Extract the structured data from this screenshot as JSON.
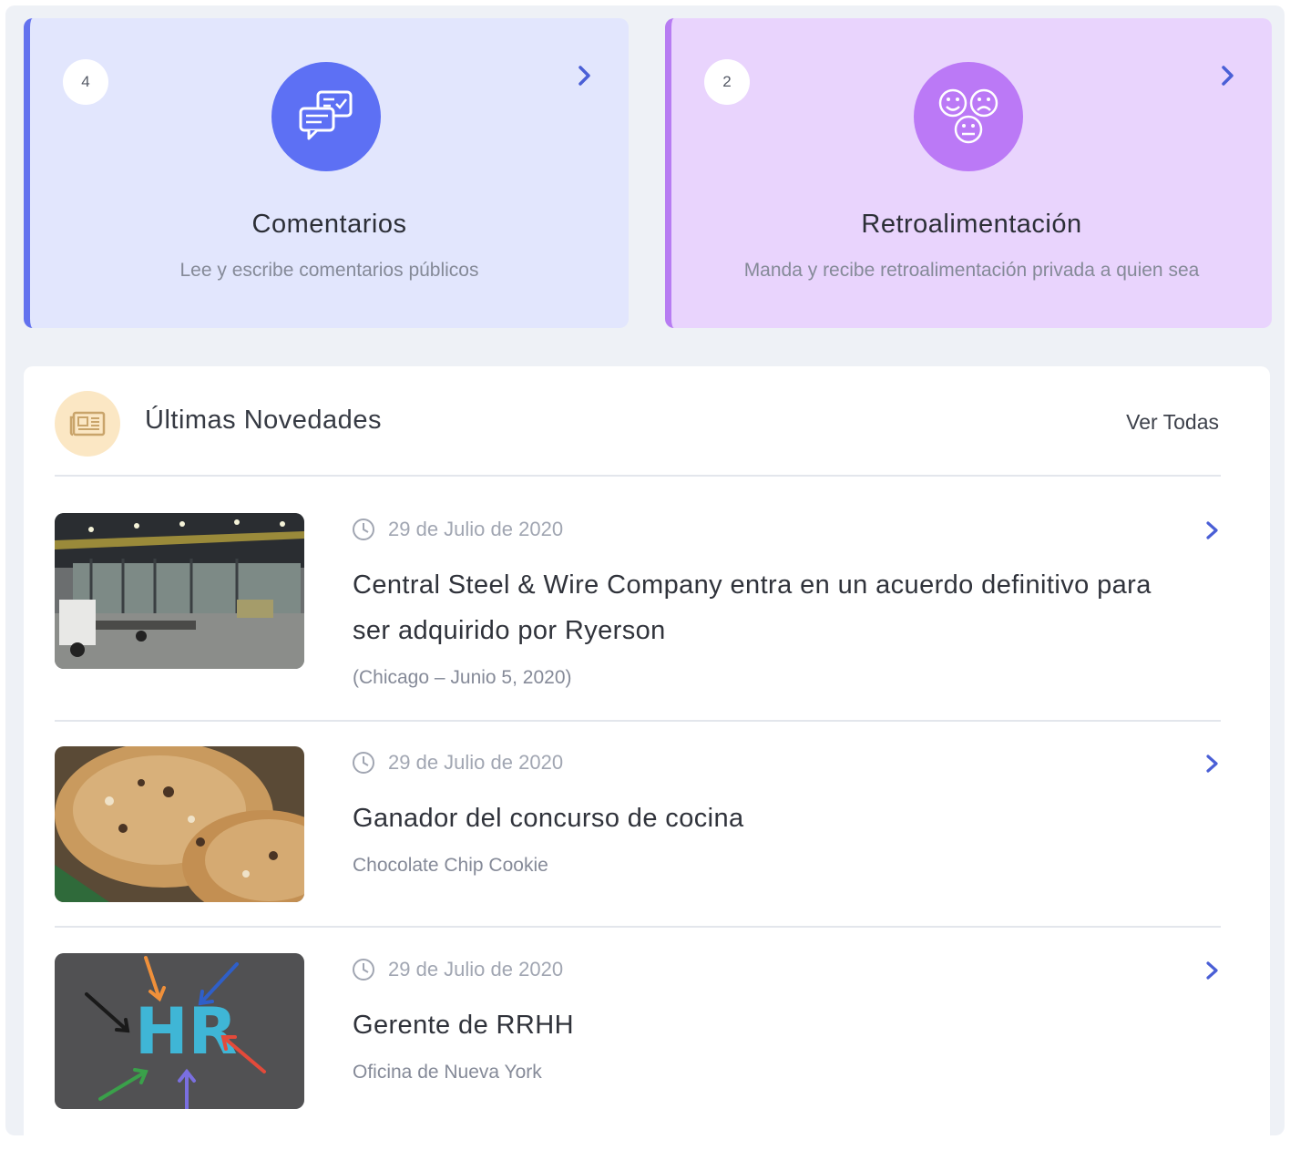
{
  "cards": [
    {
      "badge": "4",
      "title": "Comentarios",
      "description": "Lee y escribe comentarios públicos",
      "icon": "chat-bubbles-icon",
      "accent": "#6372ee",
      "background": "#e2e6fd"
    },
    {
      "badge": "2",
      "title": "Retroalimentación",
      "description": "Manda y recibe retroalimentación privada a quien sea",
      "icon": "faces-icon",
      "accent": "#b77cf2",
      "background": "#e9d4fd"
    }
  ],
  "news": {
    "title": "Últimas Novedades",
    "view_all": "Ver Todas",
    "icon": "newspaper-icon",
    "items": [
      {
        "date": "29 de Julio de 2020",
        "title": "Central Steel & Wire Company entra en un acuerdo definitivo para ser adquirido por Ryerson",
        "subtitle": "(Chicago – Junio 5, 2020)",
        "image": "warehouse-photo"
      },
      {
        "date": "29 de Julio de 2020",
        "title": "Ganador del concurso de cocina",
        "subtitle": "Chocolate Chip Cookie",
        "image": "cookies-photo"
      },
      {
        "date": "29 de Julio de 2020",
        "title": "Gerente de RRHH",
        "subtitle": "Oficina de Nueva York",
        "image": "hr-arrows-photo"
      }
    ]
  }
}
